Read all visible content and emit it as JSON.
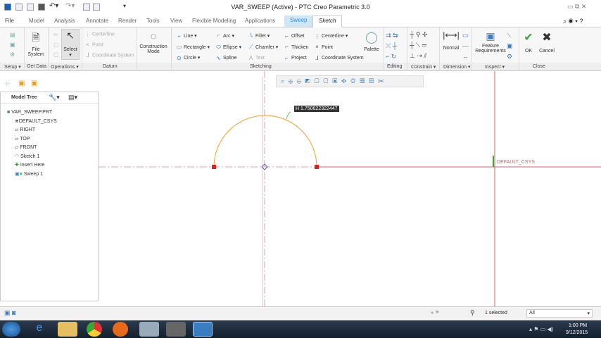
{
  "window": {
    "title": "VAR_SWEEP (Active) - PTC Creo Parametric 3.0"
  },
  "tabs": [
    "File",
    "Model",
    "Analysis",
    "Annotate",
    "Render",
    "Tools",
    "View",
    "Flexible Modeling",
    "Applications",
    "Sweep",
    "Sketch"
  ],
  "ribbon": {
    "file_system": "File\nSystem",
    "select": "Select",
    "datum": [
      "Centerline",
      "Point",
      "Coordinate System"
    ],
    "construction_mode": "Construction Mode",
    "sketching_col1": [
      "Line",
      "Rectangle",
      "Circle"
    ],
    "sketching_col2": [
      "Arc",
      "Ellipse",
      "Spline"
    ],
    "sketching_col3": [
      "Fillet",
      "Chamfer",
      "Text"
    ],
    "sketching_col4": [
      "Offset",
      "Thicken",
      "Project"
    ],
    "sketching_col5": [
      "Centerline",
      "Point",
      "Coordinate System"
    ],
    "palette": "Palette",
    "normal": "Normal",
    "feature_requirements": "Feature Requirements",
    "ok": "OK",
    "cancel": "Cancel"
  },
  "groups": [
    "Setup",
    "Get Data",
    "Operations",
    "Datum",
    "Sketching",
    "Editing",
    "Constrain",
    "Dimension",
    "Inspect",
    "Close"
  ],
  "model_tree": {
    "title": "Model Tree",
    "items": [
      "VAR_SWEEP.PRT",
      "DEFAULT_CSYS",
      "RIGHT",
      "TOP",
      "FRONT",
      "Sketch 1",
      "Insert Here",
      "Sweep 1"
    ]
  },
  "canvas": {
    "dimension_value": "H 1.750622322447",
    "csys_label": "DEFAULT_CSYS"
  },
  "status": {
    "selected": "1 selected",
    "filter": "All"
  },
  "taskbar": {
    "time": "1:00 PM",
    "date": "9/12/2015"
  },
  "colors": {
    "sketch_arc": "#f0a030",
    "accent": "#3a8fd8",
    "ok_green": "#3aa53a"
  }
}
